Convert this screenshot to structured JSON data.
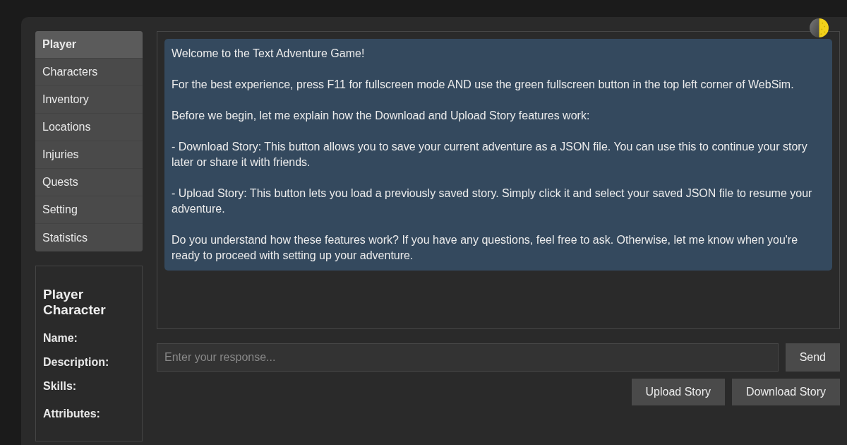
{
  "sidebar": {
    "items": [
      {
        "label": "Player",
        "selected": true
      },
      {
        "label": "Characters",
        "selected": false
      },
      {
        "label": "Inventory",
        "selected": false
      },
      {
        "label": "Locations",
        "selected": false
      },
      {
        "label": "Injuries",
        "selected": false
      },
      {
        "label": "Quests",
        "selected": false
      },
      {
        "label": "Setting",
        "selected": false
      },
      {
        "label": "Statistics",
        "selected": false
      }
    ]
  },
  "player_panel": {
    "title": "Player Character",
    "fields": [
      {
        "label": "Name:",
        "kind": "line"
      },
      {
        "label": "Description:",
        "kind": "line"
      },
      {
        "label": "Skills:",
        "kind": "line"
      },
      {
        "label": "Attributes:",
        "kind": "list"
      }
    ]
  },
  "chat": {
    "messages": [
      {
        "paragraphs": [
          "Welcome to the Text Adventure Game!",
          "For the best experience, press F11 for fullscreen mode AND use the green fullscreen button in the top left corner of WebSim.",
          "Before we begin, let me explain how the Download and Upload Story features work:",
          "- Download Story: This button allows you to save your current adventure as a JSON file. You can use this to continue your story later or share it with friends.",
          "- Upload Story: This button lets you load a previously saved story. Simply click it and select your saved JSON file to resume your adventure.",
          "Do you understand how these features work? If you have any questions, feel free to ask. Otherwise, let me know when you're ready to proceed with setting up your adventure."
        ]
      }
    ]
  },
  "input": {
    "placeholder": "Enter your response..."
  },
  "buttons": {
    "send": "Send",
    "story": [
      "Upload Story",
      "Download Story"
    ]
  }
}
